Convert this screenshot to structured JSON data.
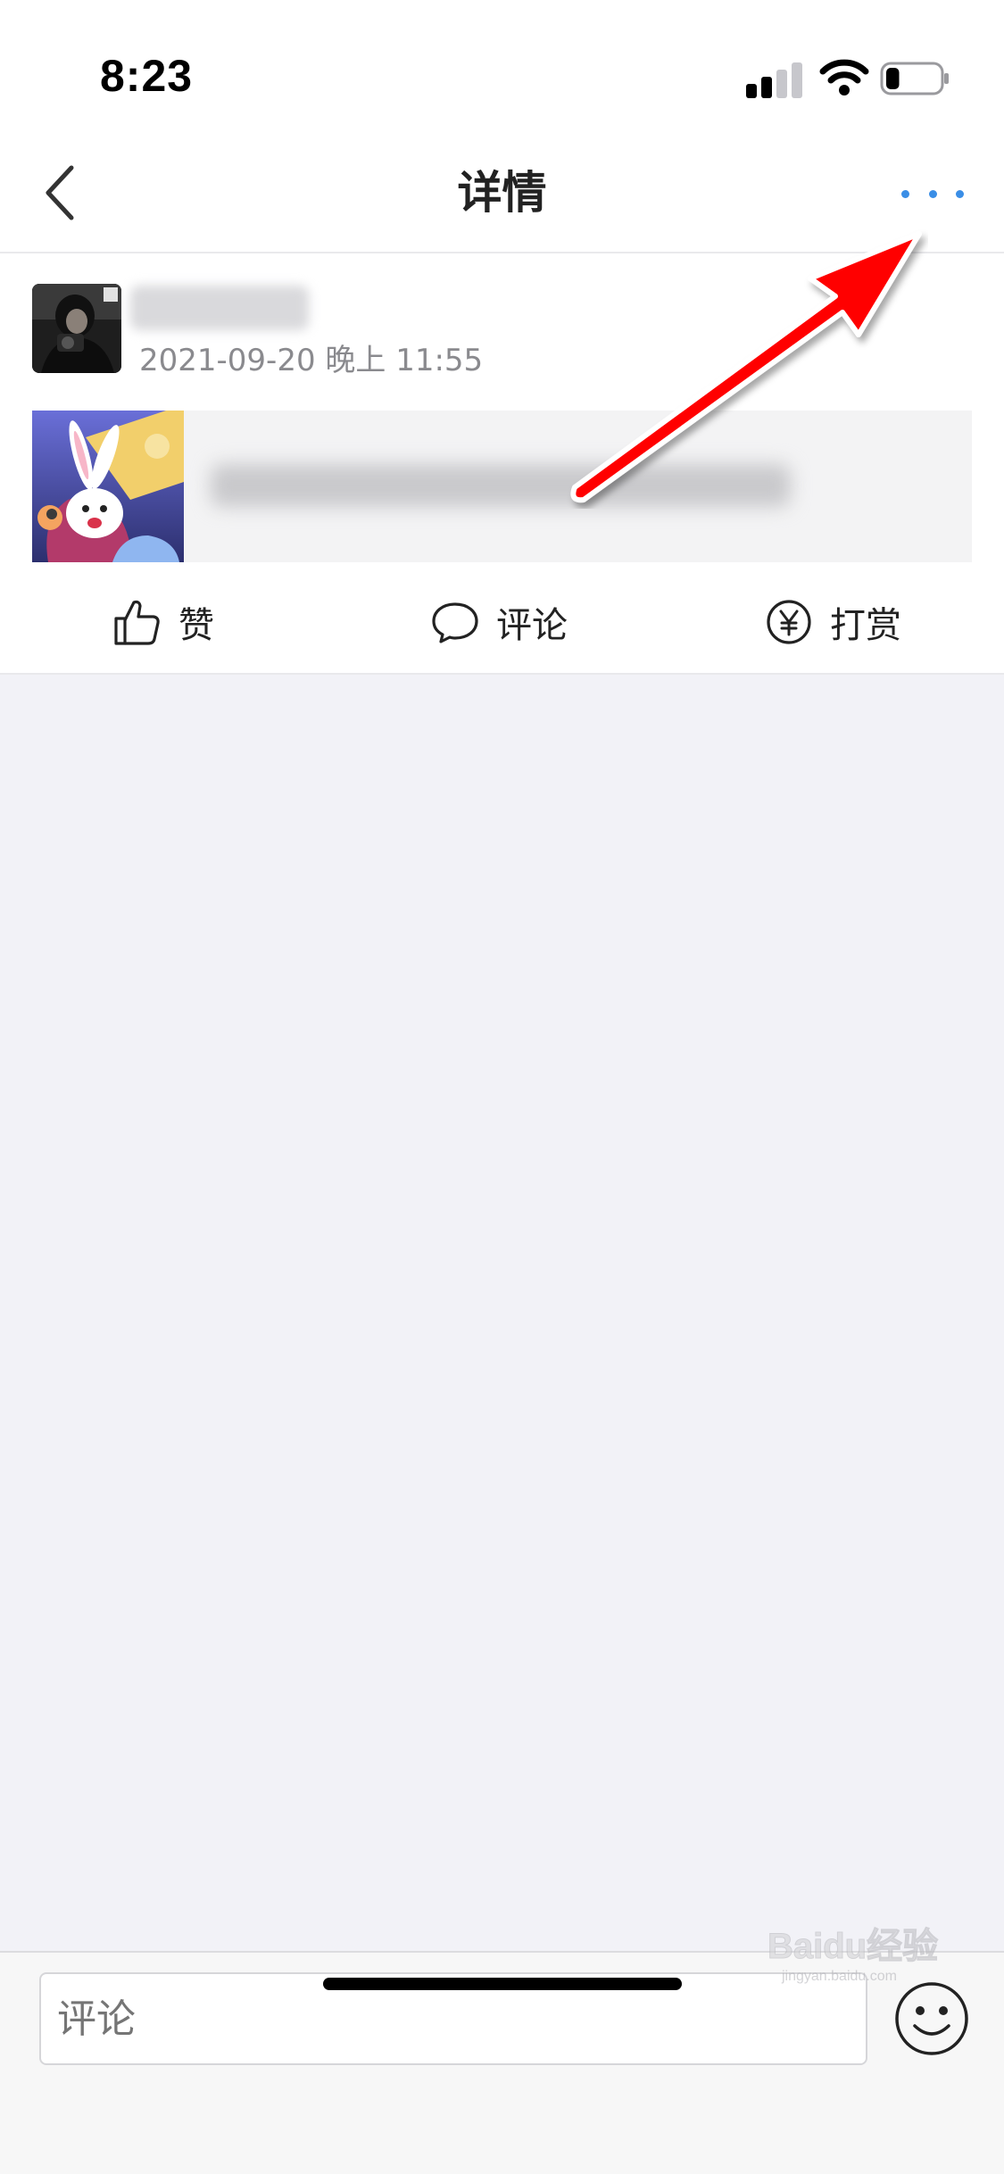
{
  "status_bar": {
    "time": "8:23",
    "signal_icon": "cellular-signal-icon",
    "wifi_icon": "wifi-icon",
    "battery_icon": "battery-icon",
    "battery_level": 0.25
  },
  "nav": {
    "title": "详情",
    "back_icon": "chevron-left-icon",
    "more_icon": "more-dots-icon",
    "more_color": "#3a8ee6"
  },
  "post": {
    "timestamp": "2021-09-20 晚上 11:55"
  },
  "actions": {
    "like_label": "赞",
    "comment_label": "评论",
    "reward_label": "打赏"
  },
  "comment_bar": {
    "placeholder": "评论",
    "emoji_icon": "smiley-face-icon"
  },
  "annotation": {
    "arrow_color": "#ff0000"
  },
  "watermark": {
    "main": "Baidu经验",
    "sub": "jingyan.baidu.com"
  }
}
